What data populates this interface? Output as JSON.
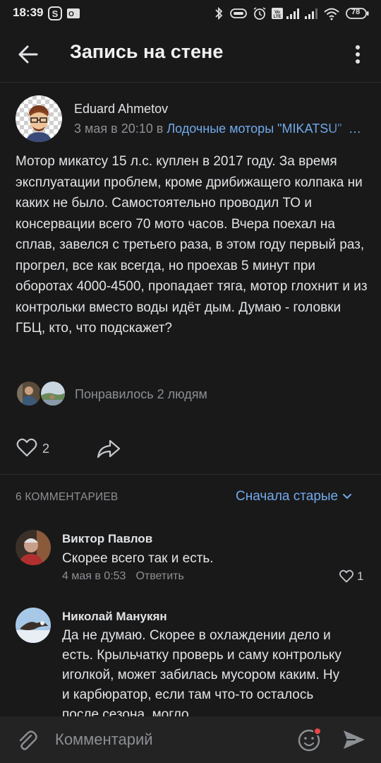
{
  "status_bar": {
    "time": "18:39",
    "battery": "78"
  },
  "header": {
    "title": "Запись на стене"
  },
  "post": {
    "author": "Eduard Ahmetov",
    "date": "3 мая в 20:10 в ",
    "group": "Лодочные моторы \"MIKATSU\"",
    "text": "Мотор микатсу 15 л.с. куплен в 2017 году. За время эксплуатации проблем, кроме дрибижащего колпака ни каких не было. Самостоятельно проводил ТО и консервации всего 70 мото часов. Вчера поехал на сплав, завелся с третьего раза, в этом году первый раз, прогрел, все как всегда, но проехав 5 минут при оборотах 4000-4500, пропадает тяга, мотор глохнит и из контрольки вместо воды идёт дым. Думаю - головки ГБЦ, кто, что подскажет?",
    "likes_text": "Понравилось 2 людям",
    "like_count": "2"
  },
  "comments_section": {
    "count_label": "6 КОММЕНТАРИЕВ",
    "sort_label": "Сначала старые"
  },
  "comments": [
    {
      "author": "Виктор Павлов",
      "text": "Скорее всего так и есть.",
      "date": "4 мая в 0:53",
      "reply_label": "Ответить",
      "likes": "1"
    },
    {
      "author": "Николай Манукян",
      "text": "Да не думаю. Скорее в охлаждении дело и есть. Крыльчатку проверь и саму контрольку иголкой, может забилась мусором каким. Ну и карбюратор, если там что-то осталось после сезона, могло"
    }
  ],
  "composer": {
    "placeholder": "Комментарий"
  },
  "colors": {
    "background": "#191919",
    "accent": "#71aaeb",
    "secondary_text": "#8c8f94",
    "notification_dot": "#e64646"
  }
}
